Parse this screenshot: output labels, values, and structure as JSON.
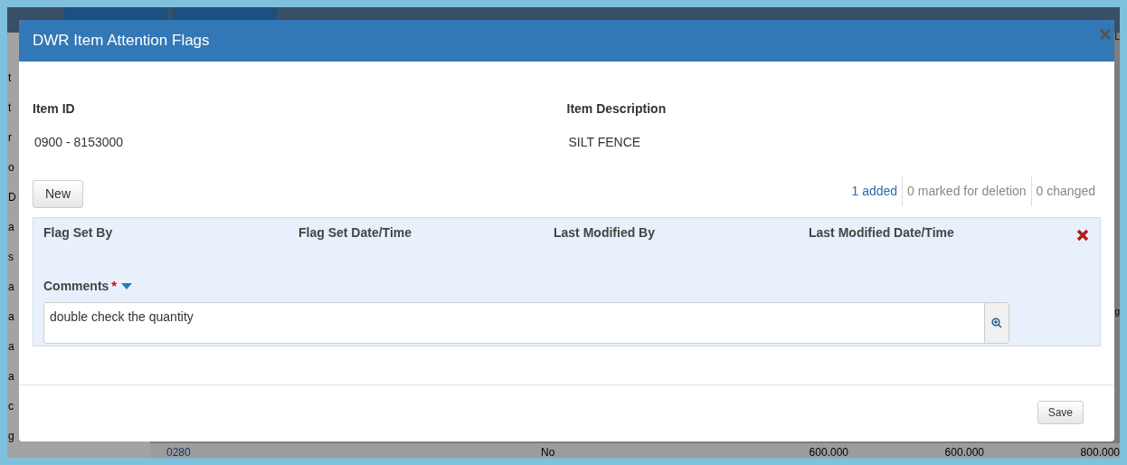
{
  "background": {
    "left_fragments": [
      "t",
      "t",
      "r",
      "o",
      "D",
      "a",
      "s",
      "a",
      "a",
      "a",
      "a",
      "c",
      "g"
    ],
    "top_right_fragment": "L",
    "right_fragment": "g",
    "bottom_row": [
      "0280",
      "No",
      "600.000",
      "600.000",
      "800.000"
    ]
  },
  "dialog": {
    "title": "DWR Item Attention Flags",
    "fields": [
      {
        "label": "Item ID",
        "value": "0900 - 8153000"
      },
      {
        "label": "Item Description",
        "value": "SILT FENCE"
      }
    ],
    "new_button": "New",
    "counts": [
      {
        "text": "1 added",
        "kind": "link"
      },
      {
        "text": "0 marked for deletion",
        "kind": "plain"
      },
      {
        "text": "0 changed",
        "kind": "plain"
      }
    ],
    "record": {
      "columns": [
        "Flag Set By",
        "Flag Set Date/Time",
        "Last Modified By",
        "Last Modified Date/Time"
      ],
      "comments": {
        "label": "Comments",
        "required_mark": "*",
        "value": "double check the quantity"
      }
    },
    "save_button": "Save"
  }
}
